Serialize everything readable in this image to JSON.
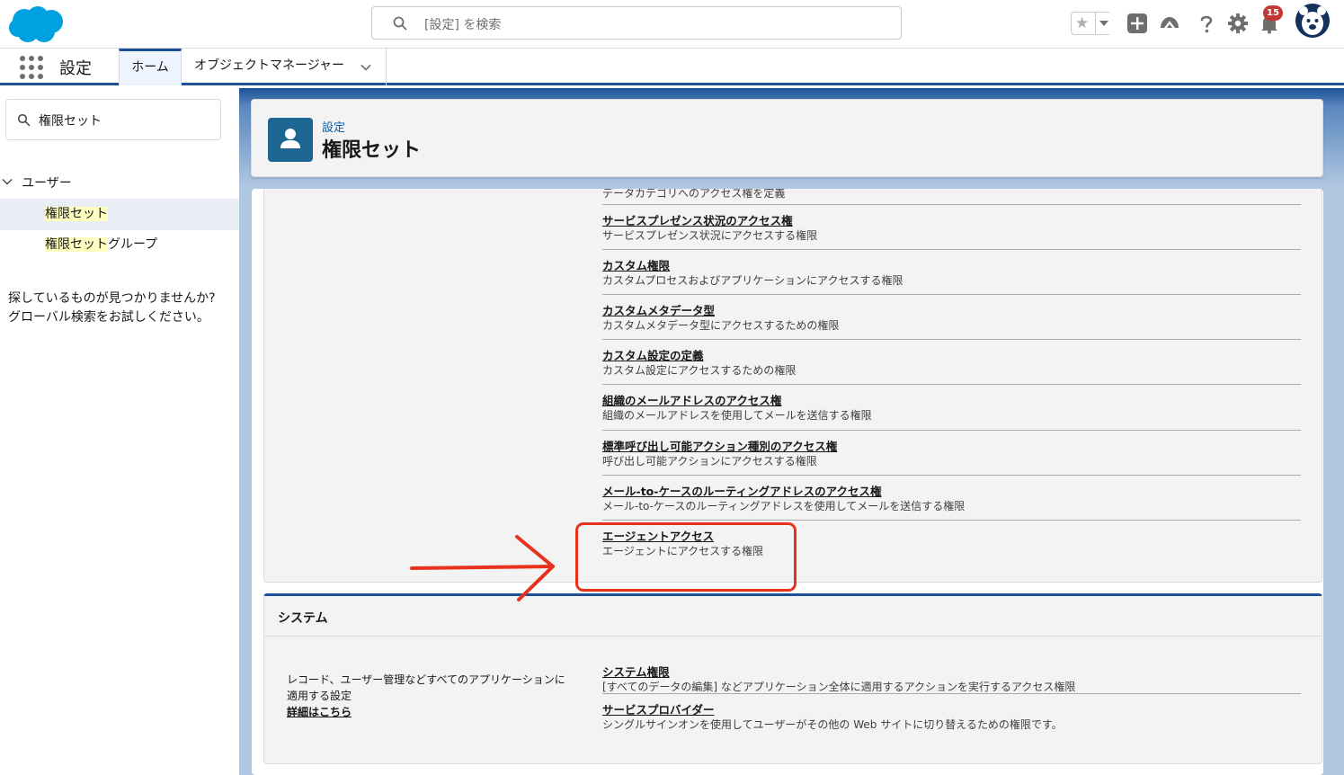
{
  "header": {
    "search_placeholder": "[設定] を検索",
    "notification_count": "15",
    "icons": [
      "salesforce-logo",
      "search-icon",
      "star-icon",
      "add-icon",
      "trailhead-icon",
      "help-icon",
      "gear-icon",
      "bell-icon",
      "avatar"
    ],
    "accent": "#1b5297"
  },
  "nav": {
    "app_name": "設定",
    "tabs": [
      {
        "label": "ホーム"
      },
      {
        "label": "オブジェクトマネージャー"
      }
    ]
  },
  "sidebar": {
    "quick_find_value": "権限セット",
    "tree_root": "ユーザー",
    "items": [
      {
        "highlight": "権限セット",
        "rest": ""
      },
      {
        "highlight": "権限セット",
        "rest": "グループ"
      }
    ],
    "not_found_line1": "探しているものが見つかりませんか?",
    "not_found_line2": "グローバル検索をお試しください。"
  },
  "page_header": {
    "breadcrumb": "設定",
    "title": "権限セット"
  },
  "permissions_card": {
    "cut_off_text": "データカテゴリへのアクセス権を定義",
    "rows": [
      {
        "name": "サービスプレゼンス状況のアクセス権",
        "desc": "サービスプレゼンス状況にアクセスする権限"
      },
      {
        "name": "カスタム権限",
        "desc": "カスタムプロセスおよびアプリケーションにアクセスする権限"
      },
      {
        "name": "カスタムメタデータ型",
        "desc": "カスタムメタデータ型にアクセスするための権限"
      },
      {
        "name": "カスタム設定の定義",
        "desc": "カスタム設定にアクセスするための権限"
      },
      {
        "name": "組織のメールアドレスのアクセス権",
        "desc": "組織のメールアドレスを使用してメールを送信する権限"
      },
      {
        "name": "標準呼び出し可能アクション種別のアクセス権",
        "desc": "呼び出し可能アクションにアクセスする権限"
      },
      {
        "name": "メール-to-ケースのルーティングアドレスのアクセス権",
        "desc": "メール-to-ケースのルーティングアドレスを使用してメールを送信する権限"
      },
      {
        "name": "エージェントアクセス",
        "desc": "エージェントにアクセスする権限"
      }
    ],
    "annotation_color": "#e8321e"
  },
  "system_card": {
    "title": "システム",
    "description_line1": "レコード、ユーザー管理などすべてのアプリケーションに",
    "description_line2": "適用する設定",
    "more_link": "詳細はこちら",
    "rows": [
      {
        "name": "システム権限",
        "desc": "[すべてのデータの編集] などアプリケーション全体に適用するアクションを実行するアクセス権限"
      },
      {
        "name": "サービスプロバイダー",
        "desc": "シングルサインオンを使用してユーザーがその他の Web サイトに切り替えるための権限です。"
      }
    ]
  }
}
